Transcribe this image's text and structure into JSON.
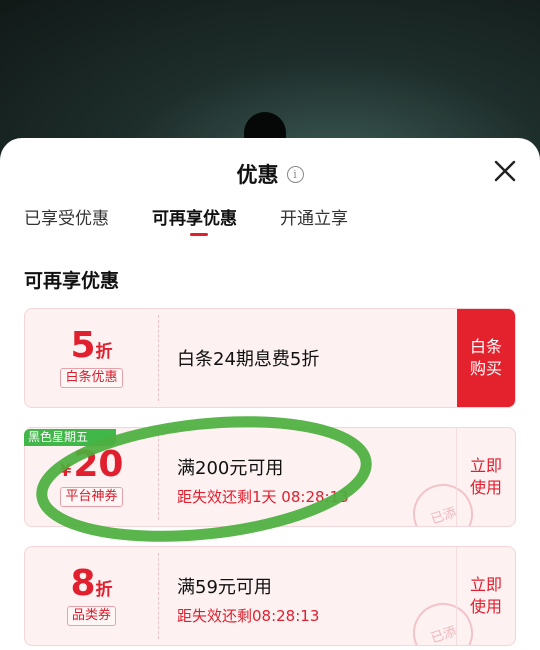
{
  "sheet": {
    "title": "优惠"
  },
  "tabs": [
    {
      "label": "已享受优惠"
    },
    {
      "label": "可再享优惠"
    },
    {
      "label": "开通立享"
    }
  ],
  "section_title": "可再享优惠",
  "coupons": [
    {
      "amount": "5",
      "unit": "折",
      "tag": "白条优惠",
      "condition": "白条24期息费5折",
      "expire": "",
      "action": "白条购买",
      "action_style": "filled"
    },
    {
      "badge": "黑色星期五",
      "currency": "¥",
      "amount": "20",
      "unit": "",
      "tag": "平台神券",
      "condition": "满200元可用",
      "expire": "距失效还剩1天 08:28:13",
      "action": "立即使用",
      "action_style": "text",
      "stamp": "已添"
    },
    {
      "amount": "8",
      "unit": "折",
      "tag": "品类券",
      "condition": "满59元可用",
      "expire": "距失效还剩08:28:13",
      "action": "立即使用",
      "action_style": "text",
      "stamp": "已添"
    }
  ],
  "colors": {
    "accent": "#e0202e",
    "badge_green": "#41b74a",
    "annotation_green": "#4caf3e"
  },
  "icons": {
    "info": "info-icon",
    "close": "close-icon"
  }
}
